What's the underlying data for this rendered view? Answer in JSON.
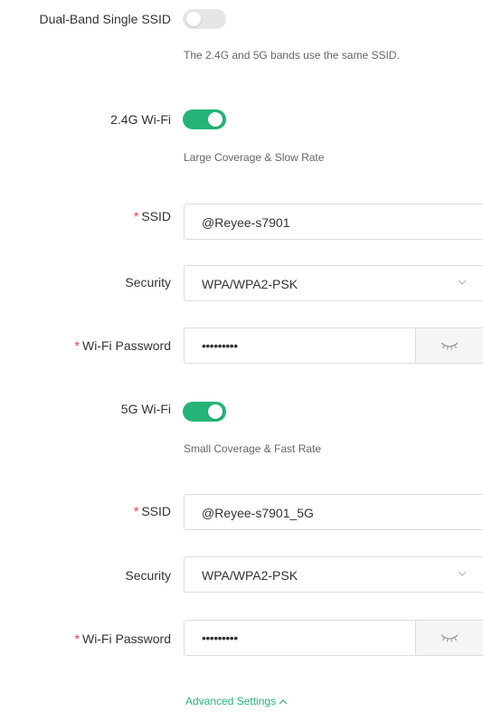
{
  "dual_band": {
    "label": "Dual-Band Single SSID",
    "enabled": false,
    "hint": "The 2.4G and 5G bands use the same SSID."
  },
  "band_24": {
    "label": "2.4G Wi-Fi",
    "enabled": true,
    "hint": "Large Coverage & Slow Rate",
    "ssid_label": "SSID",
    "ssid_value": "@Reyee-s7901",
    "security_label": "Security",
    "security_value": "WPA/WPA2-PSK",
    "password_label": "Wi-Fi Password",
    "password_masked": "•••••••••"
  },
  "band_5": {
    "label": "5G Wi-Fi",
    "enabled": true,
    "hint": "Small Coverage & Fast Rate",
    "ssid_label": "SSID",
    "ssid_value": "@Reyee-s7901_5G",
    "security_label": "Security",
    "security_value": "WPA/WPA2-PSK",
    "password_label": "Wi-Fi Password",
    "password_masked": "•••••••••"
  },
  "advanced": {
    "label": "Advanced Settings"
  },
  "required_mark": "*",
  "colors": {
    "accent": "#25b477",
    "required": "#ee3b3b",
    "switch_off": "#e6e6e6"
  },
  "icons": {
    "security_dropdown": "chevron-down-icon",
    "password_toggle": "eye-closed-icon",
    "advanced_toggle": "chevron-up-icon"
  }
}
